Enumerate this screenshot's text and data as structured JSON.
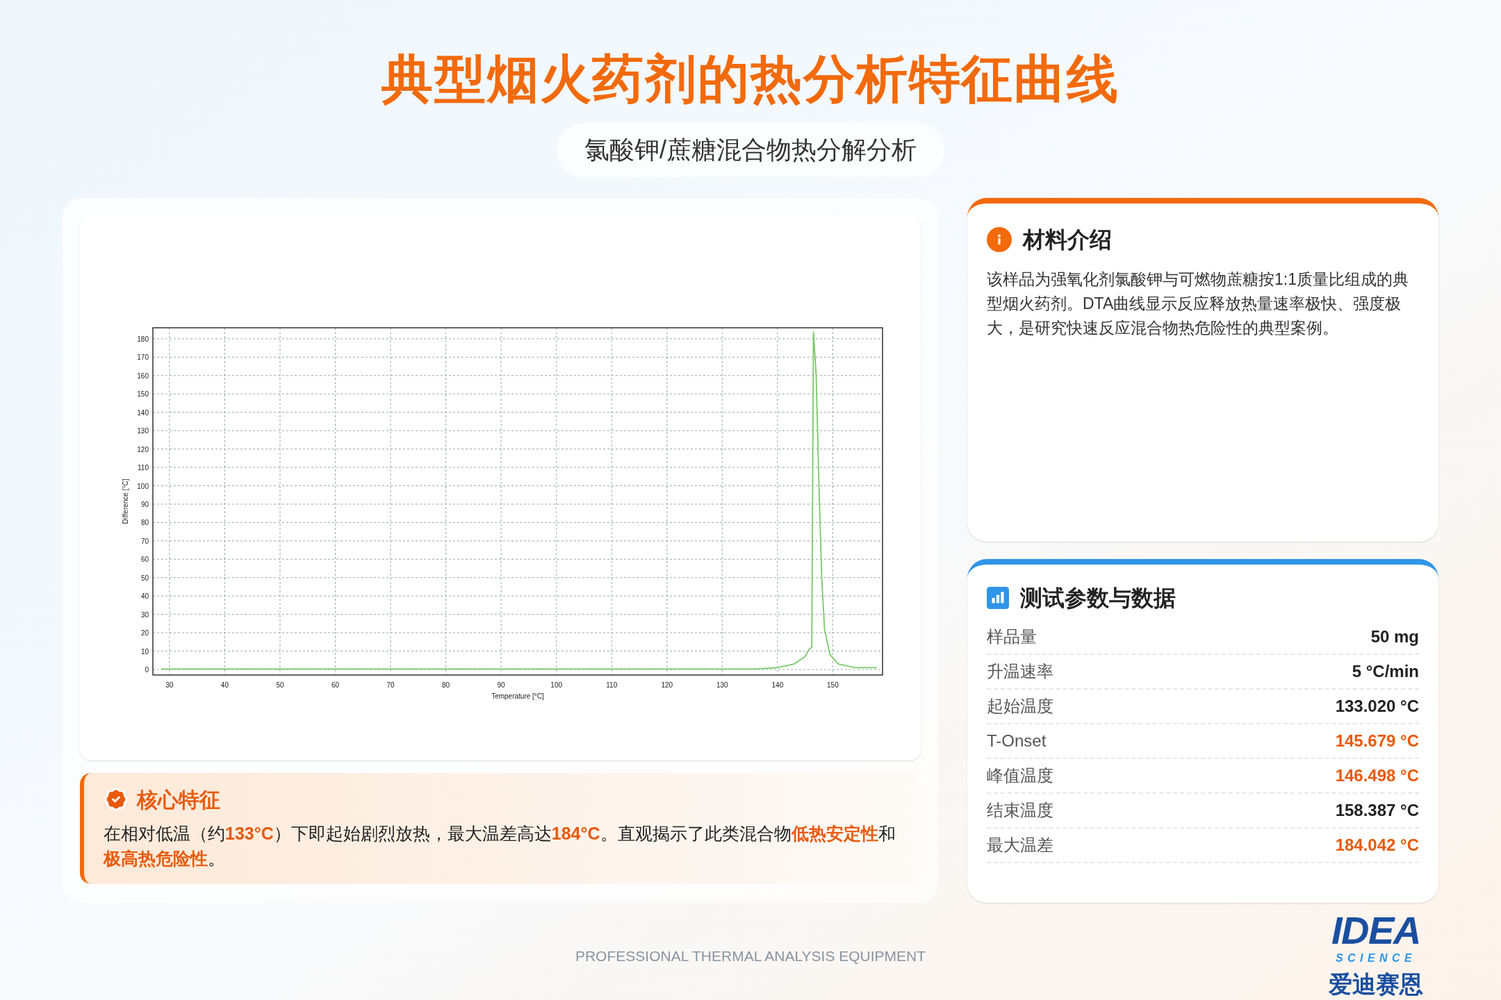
{
  "header": {
    "title": "典型烟火药剂的热分析特征曲线",
    "subtitle": "氯酸钾/蔗糖混合物热分解分析"
  },
  "chart": {
    "chart_data": {
      "type": "line",
      "xlabel": "Temperature [°C]",
      "ylabel": "Difference [°C]",
      "xlim": [
        27,
        159
      ],
      "ylim": [
        -3,
        186
      ],
      "xticks": [
        30,
        40,
        50,
        60,
        70,
        80,
        90,
        100,
        110,
        120,
        130,
        140,
        150
      ],
      "yticks": [
        0,
        10,
        20,
        30,
        40,
        50,
        60,
        70,
        80,
        90,
        100,
        110,
        120,
        130,
        140,
        150,
        160,
        170,
        180
      ],
      "x": [
        28.5,
        136,
        140,
        143,
        145,
        145.7,
        146.2,
        146.5,
        147,
        147.5,
        148,
        148.5,
        149.5,
        151,
        154,
        158
      ],
      "grid": true,
      "series": [
        {
          "color": "#7cc86a",
          "values": [
            0.3,
            0.3,
            1,
            3,
            7,
            11,
            12,
            184,
            160,
            100,
            50,
            22,
            8,
            3,
            1,
            1
          ]
        }
      ]
    }
  },
  "core": {
    "title": "核心特征",
    "text": "在相对低温（约**133°C**）下即起始剧烈放热，最大温差高达**184°C**。直观揭示了此类混合物**低热安定性**和**极高热危险性**。"
  },
  "material": {
    "title": "材料介绍",
    "text": "该样品为强氧化剂氯酸钾与可燃物蔗糖按1:1质量比组成的典型烟火药剂。DTA曲线显示反应释放热量速率极快、强度极大，是研究快速反应混合物热危险性的典型案例。"
  },
  "params": {
    "title": "测试参数与数据",
    "rows": [
      {
        "label": "样品量",
        "value": "50 mg",
        "highlight": false
      },
      {
        "label": "升温速率",
        "value": "5 °C/min",
        "highlight": false
      },
      {
        "label": "起始温度",
        "value": "133.020 °C",
        "highlight": false
      },
      {
        "label": "T-Onset",
        "value": "145.679 °C",
        "highlight": true
      },
      {
        "label": "峰值温度",
        "value": "146.498 °C",
        "highlight": true
      },
      {
        "label": "结束温度",
        "value": "158.387 °C",
        "highlight": false
      },
      {
        "label": "最大温差",
        "value": "184.042 °C",
        "highlight": true
      }
    ]
  },
  "footer": "PROFESSIONAL THERMAL ANALYSIS EQUIPMENT",
  "logo": {
    "mark": "IDEA",
    "tagline": "SCIENCE",
    "name": "爱迪赛恩"
  }
}
